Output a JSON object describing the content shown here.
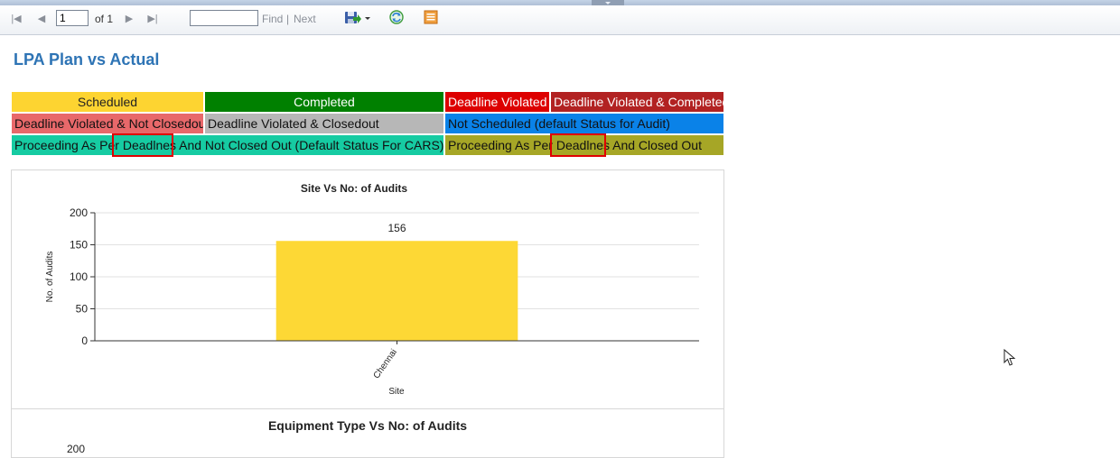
{
  "toolbar": {
    "page_number": "1",
    "page_of": "of 1",
    "find_label": "Find",
    "separator": "|",
    "next_label": "Next",
    "icons": [
      "first-page-icon",
      "previous-page-icon",
      "next-page-icon",
      "last-page-icon",
      "export-icon",
      "refresh-icon",
      "print-icon"
    ]
  },
  "report": {
    "title": "LPA Plan vs Actual"
  },
  "legend": {
    "scheduled": {
      "label": "Scheduled",
      "color": "#fdd431"
    },
    "completed": {
      "label": "Completed",
      "color": "#008000"
    },
    "deadline_violated": {
      "label": "Deadline Violated",
      "color": "#dd0000"
    },
    "deadline_violated_completed": {
      "label": "Deadline Violated & Completed",
      "color": "#b22222"
    },
    "violated_not_closedout": {
      "label": "Deadline Violated & Not Closedout",
      "color": "#e8686a"
    },
    "violated_closedout": {
      "label": "Deadline Violated & Closedout",
      "color": "#b7b7b7"
    },
    "not_scheduled": {
      "label": "Not Scheduled (default Status for Audit)",
      "color": "#0a82e8"
    },
    "proceeding_not_closed": {
      "label_before": "Proceeding As Per ",
      "label_highlight": "Deadlnes",
      "label_after": " And Not Closed Out (Default Status For CARS)",
      "color": "#16cba2"
    },
    "proceeding_closed": {
      "label_before": "Proceeding As Per ",
      "label_highlight": "Deadlnes",
      "label_after": " And Closed Out",
      "color": "#a6a626"
    }
  },
  "chart_data": [
    {
      "type": "bar",
      "title": "Site Vs No: of Audits",
      "xlabel": "Site",
      "ylabel": "No. of Audits",
      "categories": [
        "Chennai"
      ],
      "values": [
        156
      ],
      "data_labels": [
        "156"
      ],
      "ylim": [
        0,
        200
      ],
      "yticks": [
        "0",
        "50",
        "100",
        "150",
        "200"
      ],
      "grid": true,
      "bar_color": "#fdd835"
    },
    {
      "type": "bar",
      "title": "Equipment Type Vs No: of Audits",
      "yticks": [
        "200"
      ]
    }
  ]
}
